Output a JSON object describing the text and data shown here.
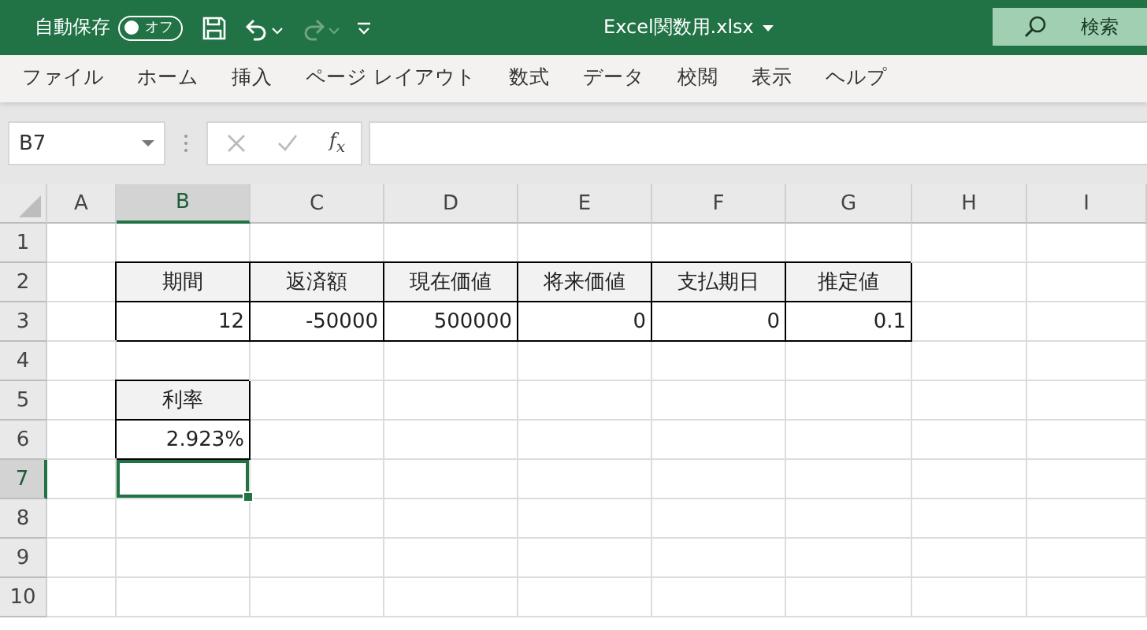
{
  "title_bar": {
    "autosave_label": "自動保存",
    "autosave": {
      "label": "オフ",
      "on": false
    },
    "quick_access": [
      {
        "kind": "save",
        "disabled": false
      },
      {
        "kind": "undo",
        "disabled": false
      },
      {
        "kind": "redo",
        "disabled": true
      }
    ],
    "file_name": "Excel関数用.xlsx",
    "search": {
      "placeholder": "検索"
    }
  },
  "ribbon_tabs": [
    {
      "label": "ファイル",
      "selected": false
    },
    {
      "label": "ホーム",
      "selected": false
    },
    {
      "label": "挿入",
      "selected": false
    },
    {
      "label": "ページ レイアウト",
      "selected": false
    },
    {
      "label": "数式",
      "selected": false
    },
    {
      "label": "データ",
      "selected": false
    },
    {
      "label": "校閲",
      "selected": false
    },
    {
      "label": "表示",
      "selected": false
    },
    {
      "label": "ヘルプ",
      "selected": false
    }
  ],
  "formula_bar": {
    "name_box": "B7",
    "function_label": "f$_{x}$"
  },
  "sheet": {
    "columns": [
      {
        "label": "A",
        "selected": false
      },
      {
        "label": "B",
        "selected": true
      },
      {
        "label": "C",
        "selected": false
      },
      {
        "label": "D",
        "selected": false
      },
      {
        "label": "E",
        "selected": false
      },
      {
        "label": "F",
        "selected": false
      },
      {
        "label": "G",
        "selected": false
      },
      {
        "label": "H",
        "selected": false
      },
      {
        "label": "I",
        "selected": false
      }
    ],
    "rows": [
      {
        "label": "1",
        "selected": false
      },
      {
        "label": "2",
        "selected": false,
        "cells": [
          {
            "text": "",
            "kind": "blank"
          },
          {
            "text": "期間",
            "kind": "header"
          },
          {
            "text": "返済額",
            "kind": "header"
          },
          {
            "text": "現在価値",
            "kind": "header"
          },
          {
            "text": "将来価値",
            "kind": "header"
          },
          {
            "text": "支払期日",
            "kind": "header"
          },
          {
            "text": "推定値",
            "kind": "header"
          }
        ]
      },
      {
        "label": "3",
        "selected": false,
        "cells": [
          {
            "text": "",
            "kind": "blank"
          },
          {
            "text": "12",
            "kind": "value"
          },
          {
            "text": "-50000",
            "kind": "value"
          },
          {
            "text": "500000",
            "kind": "value"
          },
          {
            "text": "0",
            "kind": "value"
          },
          {
            "text": "0",
            "kind": "value"
          },
          {
            "text": "0.1",
            "kind": "value"
          }
        ]
      },
      {
        "label": "4",
        "selected": false
      },
      {
        "label": "5",
        "selected": false,
        "cells": [
          {
            "text": "",
            "kind": "blank"
          },
          {
            "text": "利率",
            "kind": "header"
          }
        ]
      },
      {
        "label": "6",
        "selected": false,
        "cells": [
          {
            "text": "",
            "kind": "blank"
          },
          {
            "text": "2.923%",
            "kind": "value"
          }
        ]
      },
      {
        "label": "7",
        "selected": true,
        "cells": [
          {
            "text": "",
            "kind": "blank"
          },
          {
            "text": "",
            "kind": "active"
          }
        ]
      },
      {
        "label": "8",
        "selected": false
      },
      {
        "label": "9",
        "selected": false
      },
      {
        "label": "10",
        "selected": false
      }
    ]
  }
}
